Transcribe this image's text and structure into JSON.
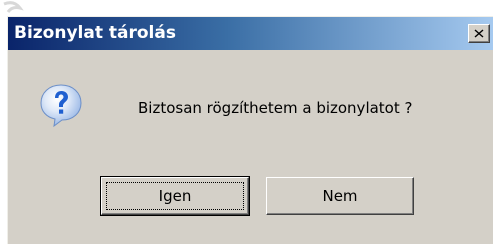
{
  "window": {
    "title": "Bizonylat tárolás"
  },
  "dialog": {
    "message": "Biztosan rögzíthetem a bizonylatot ?",
    "icon": "question-icon"
  },
  "buttons": {
    "yes_label": "Igen",
    "no_label": "Nem"
  },
  "colors": {
    "titlebar_start": "#0a246a",
    "titlebar_end": "#a6caf0",
    "dialog_bg": "#d4d0c8",
    "icon_blue": "#1f5fd0"
  }
}
